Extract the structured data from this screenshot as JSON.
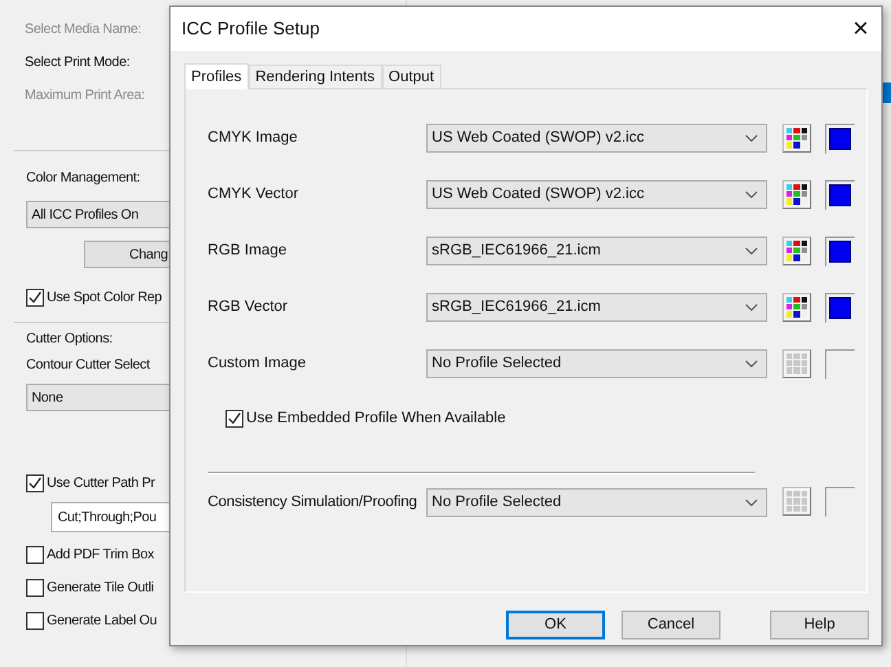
{
  "background": {
    "fields": [
      {
        "label": "Select Media Name:",
        "disabled": true
      },
      {
        "label": "Select Print Mode:",
        "disabled": false
      },
      {
        "label": "Maximum Print Area:",
        "disabled": true
      }
    ],
    "color_management": {
      "title": "Color Management:",
      "dropdown": "All ICC Profiles On",
      "button": "Chang",
      "checkbox": {
        "label": "Use Spot Color Rep",
        "checked": true
      }
    },
    "cutter_options": {
      "title": "Cutter Options:",
      "label": "Contour Cutter Select",
      "dropdown": "None",
      "path_checkbox": {
        "label": "Use Cutter Path Pr",
        "checked": true
      },
      "field": "Cut;Through;Pou",
      "checkboxes": [
        {
          "label": "Add PDF Trim Box",
          "checked": false
        },
        {
          "label": "Generate Tile Outli",
          "checked": false
        },
        {
          "label": "Generate Label Ou",
          "checked": false
        }
      ]
    }
  },
  "dialog": {
    "title": "ICC Profile Setup",
    "close": "×",
    "tabs": [
      {
        "label": "Profiles",
        "selected": true
      },
      {
        "label": "Rendering Intents",
        "selected": false
      },
      {
        "label": "Output",
        "selected": false
      }
    ],
    "profiles": [
      {
        "label": "CMYK Image",
        "value": "US Web Coated (SWOP) v2.icc",
        "enabled": true
      },
      {
        "label": "CMYK Vector",
        "value": "US Web Coated (SWOP) v2.icc",
        "enabled": true
      },
      {
        "label": "RGB Image",
        "value": "sRGB_IEC61966_21.icm",
        "enabled": true
      },
      {
        "label": "RGB Vector",
        "value": "sRGB_IEC61966_21.icm",
        "enabled": true
      },
      {
        "label": "Custom Image",
        "value": "No Profile Selected",
        "enabled": false
      }
    ],
    "embedded": {
      "label": "Use Embedded Profile When Available",
      "checked": true
    },
    "proofing": {
      "label": "Consistency Simulation/Proofing",
      "value": "No Profile Selected",
      "enabled": false
    },
    "buttons": [
      {
        "label": "OK",
        "default": true
      },
      {
        "label": "Cancel",
        "default": false
      },
      {
        "label": "Help",
        "default": false
      }
    ]
  }
}
